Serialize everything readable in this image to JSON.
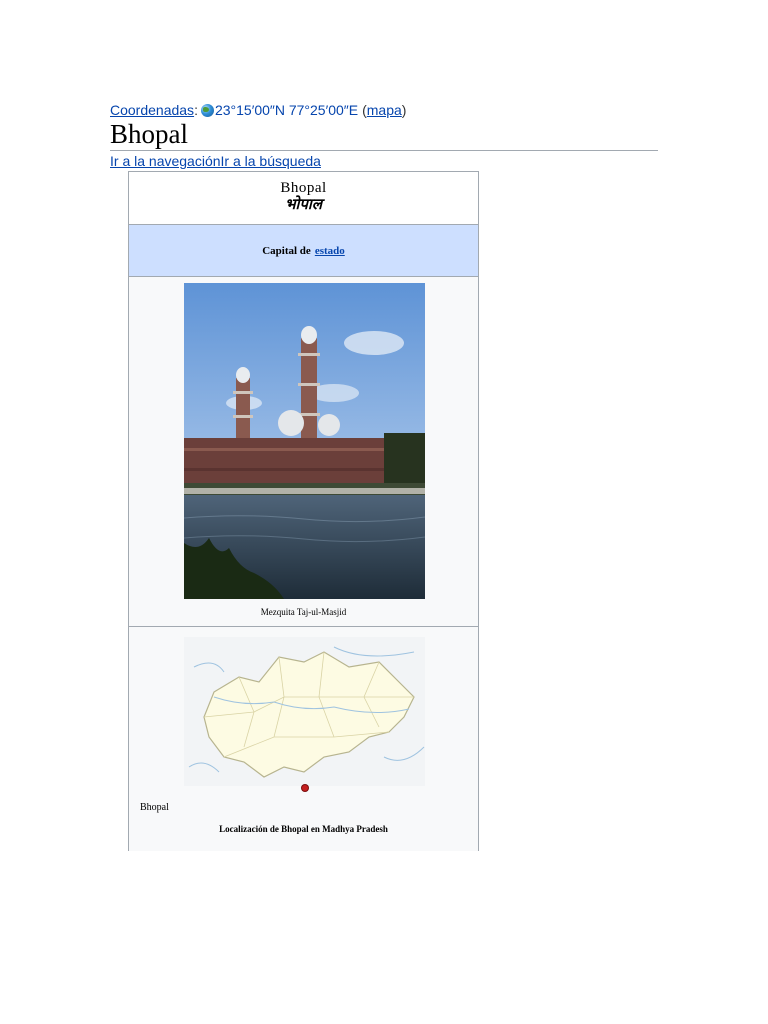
{
  "coordinates": {
    "label": "Coordenadas",
    "separator": ":",
    "value": "23°15′00″N 77°25′00″E",
    "map_open": "(",
    "map_link": "mapa",
    "map_close": ")",
    "icon": "globe-icon"
  },
  "page": {
    "title": "Bhopal",
    "skip_navigation": "Ir a la navegación",
    "skip_search": "Ir a la búsqueda"
  },
  "infobox": {
    "name": "Bhopal",
    "native_name": "भोपाल",
    "type_prefix": "Capital de",
    "type_link": "estado",
    "photo_caption": "Mezquita Taj-ul-Masjid",
    "map_label": "Bhopal",
    "map_caption": "Localización de Bhopal en Madhya Pradesh",
    "colors": {
      "header_band": "#cddfff",
      "border": "#a2a9b1",
      "link": "#0645ad",
      "marker": "#c41e1e"
    }
  }
}
